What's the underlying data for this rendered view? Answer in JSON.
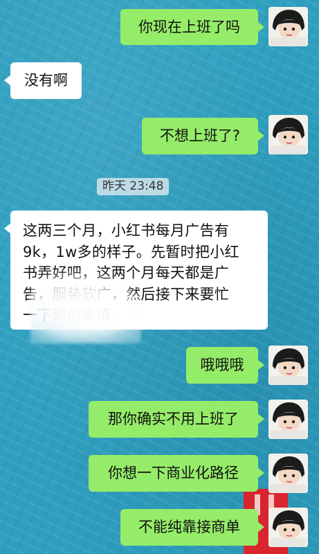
{
  "colors": {
    "chat_background": "#2e9fbf",
    "outgoing_bubble": "#95ec69",
    "incoming_bubble": "#ffffff",
    "watermark_red": "#d8252e"
  },
  "timestamp": "昨天 23:48",
  "messages": [
    {
      "id": "m1",
      "direction": "outgoing",
      "text": "你现在上班了吗",
      "avatar_icon": "girl-avatar-icon"
    },
    {
      "id": "m2",
      "direction": "incoming",
      "text": "没有啊"
    },
    {
      "id": "m3",
      "direction": "outgoing",
      "text": "不想上班了?",
      "avatar_icon": "girl-avatar-icon"
    },
    {
      "id": "m4",
      "direction": "incoming",
      "lines": [
        "这两三个月，小红书每月广告有",
        "9k，1w多的样子。先暂时把小红",
        "书弄好吧，这两个月每天都是广",
        "告，服装软广，然后接下来要忙",
        "一下别的事情"
      ]
    },
    {
      "id": "m5",
      "direction": "outgoing",
      "text": "哦哦哦",
      "avatar_icon": "girl-avatar-icon"
    },
    {
      "id": "m6",
      "direction": "outgoing",
      "text": "那你确实不用上班了",
      "avatar_icon": "girl-avatar-icon"
    },
    {
      "id": "m7",
      "direction": "outgoing",
      "text": "你想一下商业化路径",
      "avatar_icon": "girl-avatar-icon"
    },
    {
      "id": "m8",
      "direction": "outgoing",
      "text": "不能纯靠接商单",
      "avatar_icon": "girl-avatar-icon"
    }
  ]
}
